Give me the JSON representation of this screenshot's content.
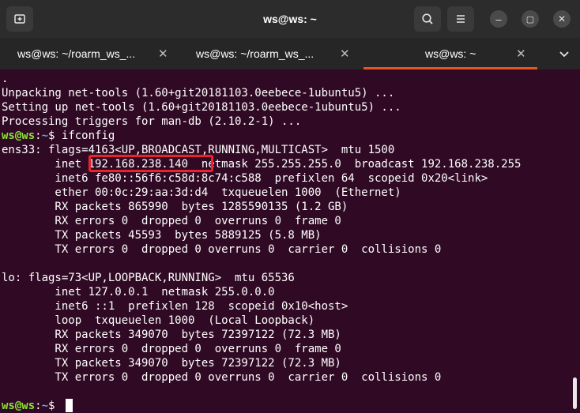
{
  "window": {
    "title": "ws@ws: ~",
    "new_tab_icon": "new-tab-icon",
    "search_icon": "search-icon",
    "menu_icon": "hamburger-menu-icon",
    "minimize_glyph": "–",
    "maximize_glyph": "▢",
    "close_glyph": "✕"
  },
  "tabs": [
    {
      "label": "ws@ws: ~/roarm_ws_...",
      "close": "✕",
      "active": false
    },
    {
      "label": "ws@ws: ~/roarm_ws_...",
      "close": "✕",
      "active": false
    },
    {
      "label": "ws@ws: ~",
      "close": "✕",
      "active": true
    }
  ],
  "tab_overflow_icon": "chevron-down-icon",
  "accent_color": "#e95420",
  "terminal": {
    "lines": [
      ".",
      "Unpacking net-tools (1.60+git20181103.0eebece-1ubuntu5) ...",
      "Setting up net-tools (1.60+git20181103.0eebece-1ubuntu5) ...",
      "Processing triggers for man-db (2.10.2-1) ...",
      "ifconfig",
      "ens33: flags=4163<UP,BROADCAST,RUNNING,MULTICAST>  mtu 1500",
      "        inet 192.168.238.140  netmask 255.255.255.0  broadcast 192.168.238.255",
      "        inet6 fe80::56f6:c58d:8c74:c588  prefixlen 64  scopeid 0x20<link>",
      "        ether 00:0c:29:aa:3d:d4  txqueuelen 1000  (Ethernet)",
      "        RX packets 865990  bytes 1285590135 (1.2 GB)",
      "        RX errors 0  dropped 0  overruns 0  frame 0",
      "        TX packets 45593  bytes 5889125 (5.8 MB)",
      "        TX errors 0  dropped 0 overruns 0  carrier 0  collisions 0",
      "",
      "lo: flags=73<UP,LOOPBACK,RUNNING>  mtu 65536",
      "        inet 127.0.0.1  netmask 255.0.0.0",
      "        inet6 ::1  prefixlen 128  scopeid 0x10<host>",
      "        loop  txqueuelen 1000  (Local Loopback)",
      "        RX packets 349070  bytes 72397122 (72.3 MB)",
      "        RX errors 0  dropped 0  overruns 0  frame 0",
      "        TX packets 349070  bytes 72397122 (72.3 MB)",
      "        TX errors 0  dropped 0 overruns 0  carrier 0  collisions 0",
      ""
    ],
    "prompt_user": "ws@ws",
    "prompt_colon": ":",
    "prompt_path": "~",
    "prompt_dollar": "$ ",
    "highlighted_ip": "192.168.238.140",
    "highlight_color": "#e8242a"
  }
}
